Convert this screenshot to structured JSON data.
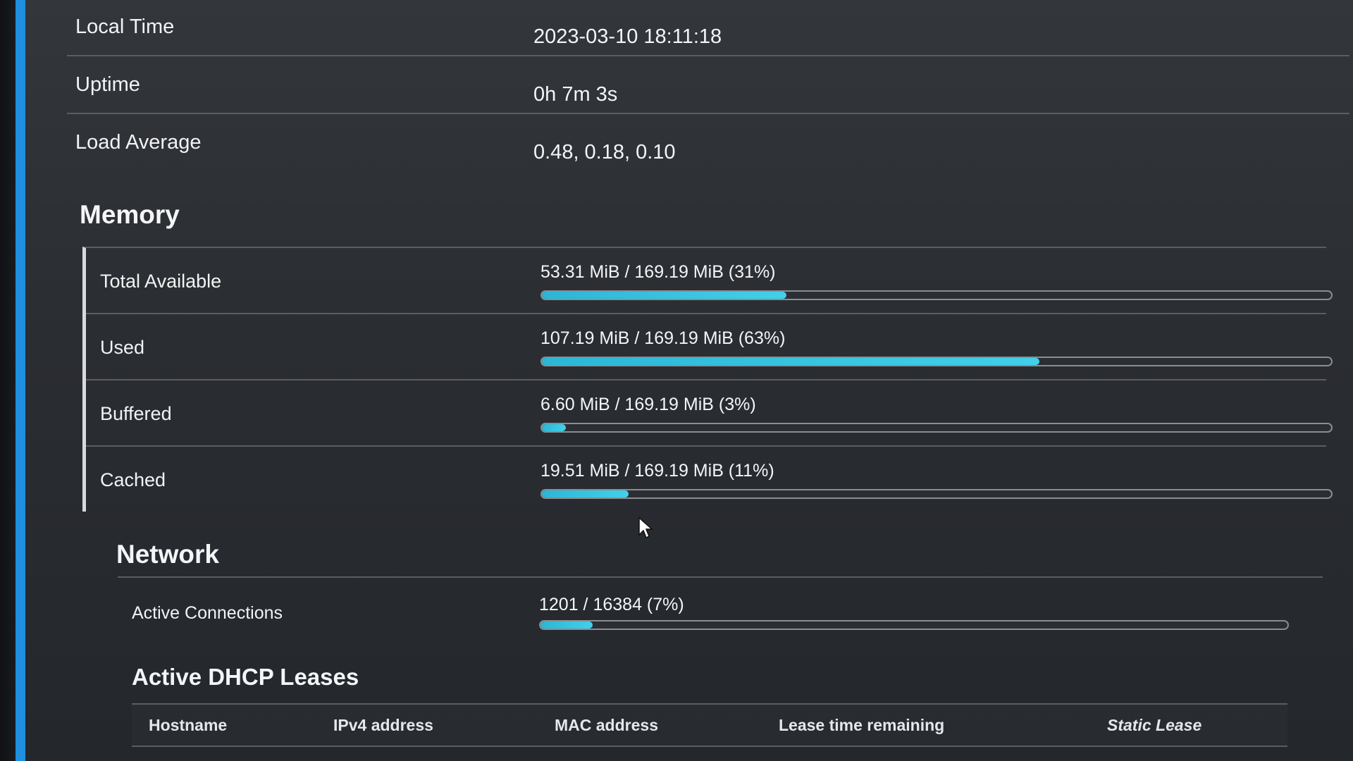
{
  "status_rows": [
    {
      "label": "Local Time",
      "value": "2023-03-10 18:11:18"
    },
    {
      "label": "Uptime",
      "value": "0h 7m 3s"
    },
    {
      "label": "Load Average",
      "value": "0.48, 0.18, 0.10"
    }
  ],
  "memory": {
    "title": "Memory",
    "rows": [
      {
        "label": "Total Available",
        "text": "53.31 MiB / 169.19 MiB (31%)",
        "percent": 31
      },
      {
        "label": "Used",
        "text": "107.19 MiB / 169.19 MiB (63%)",
        "percent": 63
      },
      {
        "label": "Buffered",
        "text": "6.60 MiB / 169.19 MiB (3%)",
        "percent": 3
      },
      {
        "label": "Cached",
        "text": "19.51 MiB / 169.19 MiB (11%)",
        "percent": 11
      }
    ]
  },
  "network": {
    "title": "Network",
    "rows": [
      {
        "label": "Active Connections",
        "text": "1201 / 16384 (7%)",
        "percent": 7
      }
    ]
  },
  "dhcp": {
    "title": "Active DHCP Leases",
    "columns": [
      "Hostname",
      "IPv4 address",
      "MAC address",
      "Lease time remaining",
      "Static Lease"
    ]
  },
  "colors": {
    "accent_stripe": "#1f8fe0",
    "bar_fill": "#2bb6d6",
    "background": "#2a2d31"
  },
  "icons": {
    "cursor": "mouse-pointer-icon"
  }
}
